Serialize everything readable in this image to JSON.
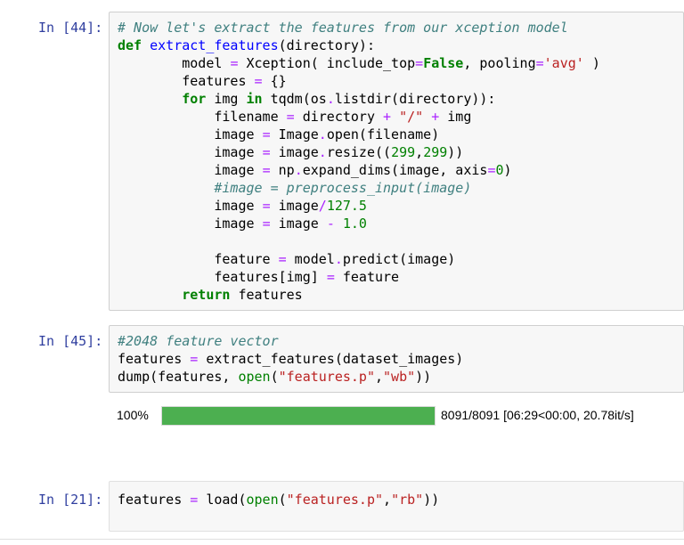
{
  "cells": [
    {
      "prompt": "In [44]:",
      "lines": [
        [
          [
            "cm",
            "# Now let's extract the features from our xception model"
          ]
        ],
        [
          [
            "kw",
            "def"
          ],
          [
            "",
            " "
          ],
          [
            "fn",
            "extract_features"
          ],
          [
            "",
            "(directory):"
          ]
        ],
        [
          [
            "",
            "        model "
          ],
          [
            "op",
            "="
          ],
          [
            "",
            " Xception( include_top"
          ],
          [
            "op",
            "="
          ],
          [
            "kw",
            "False"
          ],
          [
            "",
            ", pooling"
          ],
          [
            "op",
            "="
          ],
          [
            "st",
            "'avg'"
          ],
          [
            "",
            " )"
          ]
        ],
        [
          [
            "",
            "        features "
          ],
          [
            "op",
            "="
          ],
          [
            "",
            " {}"
          ]
        ],
        [
          [
            "",
            "        "
          ],
          [
            "kw",
            "for"
          ],
          [
            "",
            " img "
          ],
          [
            "kw",
            "in"
          ],
          [
            "",
            " tqdm(os"
          ],
          [
            "op",
            "."
          ],
          [
            "",
            "listdir(directory)):"
          ]
        ],
        [
          [
            "",
            "            filename "
          ],
          [
            "op",
            "="
          ],
          [
            "",
            " directory "
          ],
          [
            "op",
            "+"
          ],
          [
            "",
            " "
          ],
          [
            "st",
            "\"/\""
          ],
          [
            "",
            " "
          ],
          [
            "op",
            "+"
          ],
          [
            "",
            " img"
          ]
        ],
        [
          [
            "",
            "            image "
          ],
          [
            "op",
            "="
          ],
          [
            "",
            " Image"
          ],
          [
            "op",
            "."
          ],
          [
            "",
            "open(filename)"
          ]
        ],
        [
          [
            "",
            "            image "
          ],
          [
            "op",
            "="
          ],
          [
            "",
            " image"
          ],
          [
            "op",
            "."
          ],
          [
            "",
            "resize(("
          ],
          [
            "nm",
            "299"
          ],
          [
            "",
            ","
          ],
          [
            "nm",
            "299"
          ],
          [
            "",
            "))"
          ]
        ],
        [
          [
            "",
            "            image "
          ],
          [
            "op",
            "="
          ],
          [
            "",
            " np"
          ],
          [
            "op",
            "."
          ],
          [
            "",
            "expand_dims(image, axis"
          ],
          [
            "op",
            "="
          ],
          [
            "nm",
            "0"
          ],
          [
            "",
            ")"
          ]
        ],
        [
          [
            "",
            "            "
          ],
          [
            "cm",
            "#image = preprocess_input(image)"
          ]
        ],
        [
          [
            "",
            "            image "
          ],
          [
            "op",
            "="
          ],
          [
            "",
            " image"
          ],
          [
            "op",
            "/"
          ],
          [
            "nm",
            "127.5"
          ]
        ],
        [
          [
            "",
            "            image "
          ],
          [
            "op",
            "="
          ],
          [
            "",
            " image "
          ],
          [
            "op",
            "-"
          ],
          [
            "",
            " "
          ],
          [
            "nm",
            "1.0"
          ]
        ],
        [
          [
            "",
            ""
          ]
        ],
        [
          [
            "",
            "            feature "
          ],
          [
            "op",
            "="
          ],
          [
            "",
            " model"
          ],
          [
            "op",
            "."
          ],
          [
            "",
            "predict(image)"
          ]
        ],
        [
          [
            "",
            "            features[img] "
          ],
          [
            "op",
            "="
          ],
          [
            "",
            " feature"
          ]
        ],
        [
          [
            "",
            "        "
          ],
          [
            "kw",
            "return"
          ],
          [
            "",
            " features"
          ]
        ]
      ]
    },
    {
      "prompt": "In [45]:",
      "lines": [
        [
          [
            "cm",
            "#2048 feature vector"
          ]
        ],
        [
          [
            "",
            "features "
          ],
          [
            "op",
            "="
          ],
          [
            "",
            " extract_features(dataset_images)"
          ]
        ],
        [
          [
            "",
            "dump(features, "
          ],
          [
            "bi",
            "open"
          ],
          [
            "",
            "("
          ],
          [
            "st",
            "\"features.p\""
          ],
          [
            "",
            ","
          ],
          [
            "st",
            "\"wb\""
          ],
          [
            "",
            "))"
          ]
        ]
      ]
    },
    {
      "prompt": "In [21]:",
      "lines": [
        [
          [
            "",
            "features "
          ],
          [
            "op",
            "="
          ],
          [
            "",
            " load("
          ],
          [
            "bi",
            "open"
          ],
          [
            "",
            "("
          ],
          [
            "st",
            "\"features.p\""
          ],
          [
            "",
            ","
          ],
          [
            "st",
            "\"rb\""
          ],
          [
            "",
            "))"
          ]
        ]
      ]
    }
  ],
  "progress": {
    "percent_label": "100%",
    "fraction": 1.0,
    "bar_color": "#4caf50",
    "status": "8091/8091 [06:29<00:00, 20.78it/s]"
  }
}
